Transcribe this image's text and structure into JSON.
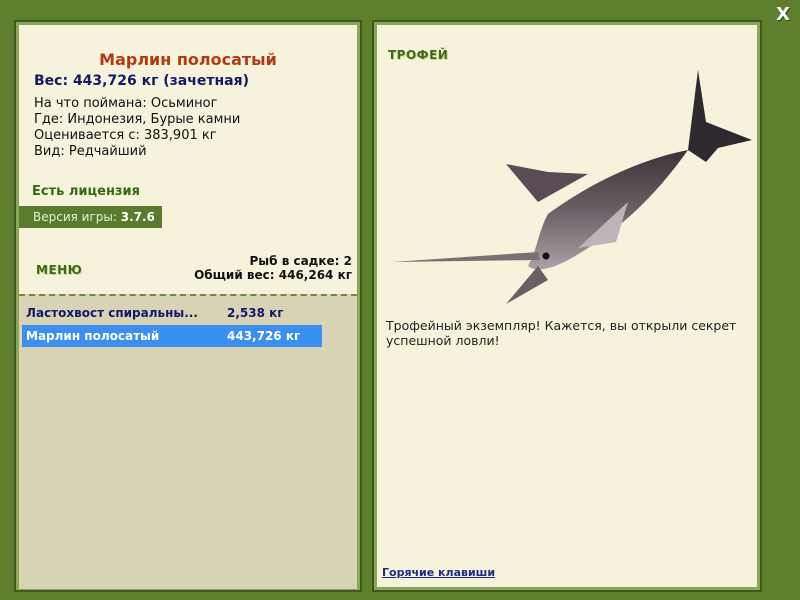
{
  "window": {
    "close_label": "X"
  },
  "fish": {
    "title": "Марлин полосатый",
    "weight_line": "Вес: 443,726 кг (зачетная)",
    "details": [
      "На что поймана: Осьминог",
      "Где: Индонезия, Бурые камни",
      "Оценивается с: 383,901 кг",
      "Вид: Редчайший"
    ]
  },
  "license": "Есть лицензия",
  "version": {
    "label": "Версия игры:",
    "value": "3.7.6"
  },
  "menu_label": "МЕНЮ",
  "cage": {
    "count_text": "Рыб в садке: 2",
    "weight_text": "Общий вес: 446,264 кг"
  },
  "catch_list": [
    {
      "name": "Ластохвост спиральны...",
      "weight": "2,538 кг",
      "selected": false
    },
    {
      "name": "Марлин полосатый",
      "weight": "443,726 кг",
      "selected": true
    }
  ],
  "trophy": {
    "label": "ТРОФЕЙ",
    "text": "Трофейный экземпляр! Кажется, вы открыли секрет успешной ловли!"
  },
  "hotkeys_label": "Горячие клавиши",
  "colors": {
    "background": "#5e7f2e",
    "panel": "#f6f2dc",
    "title_accent": "#b23a10",
    "weight_text": "#111a66",
    "selected_row": "#3b8ff0"
  },
  "icons": {
    "close": "close-icon",
    "fish_image": "marlin-image"
  }
}
